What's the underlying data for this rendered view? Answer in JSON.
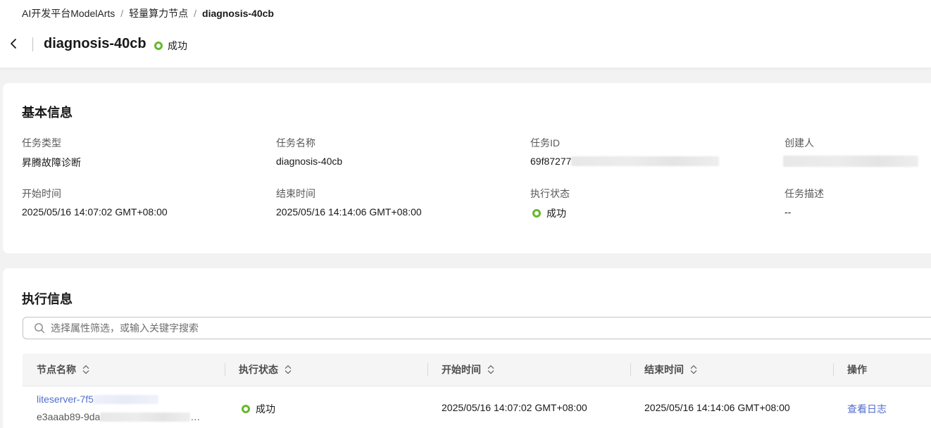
{
  "breadcrumb": {
    "items": [
      "AI开发平台ModelArts",
      "轻量算力节点"
    ],
    "current": "diagnosis-40cb",
    "separator": "/"
  },
  "header": {
    "title": "diagnosis-40cb",
    "status": "成功",
    "status_color": "#66b82e"
  },
  "basic": {
    "title": "基本信息",
    "fields": {
      "task_type": {
        "label": "任务类型",
        "value": "昇腾故障诊断"
      },
      "task_name": {
        "label": "任务名称",
        "value": "diagnosis-40cb"
      },
      "task_id": {
        "label": "任务ID",
        "value": "69f87277"
      },
      "creator": {
        "label": "创建人",
        "value": ""
      },
      "start_time": {
        "label": "开始时间",
        "value": "2025/05/16 14:07:02 GMT+08:00"
      },
      "end_time": {
        "label": "结束时间",
        "value": "2025/05/16 14:14:06 GMT+08:00"
      },
      "exec_status": {
        "label": "执行状态",
        "value": "成功"
      },
      "description": {
        "label": "任务描述",
        "value": "--"
      }
    }
  },
  "execution": {
    "title": "执行信息",
    "search_placeholder": "选择属性筛选，或输入关键字搜索",
    "columns": [
      "节点名称",
      "执行状态",
      "开始时间",
      "结束时间",
      "操作"
    ],
    "rows": [
      {
        "node_name": "liteserver-7f5",
        "node_id": "e3aaab89-9da",
        "node_id_tail": "…",
        "status": "成功",
        "start_time": "2025/05/16 14:07:02 GMT+08:00",
        "end_time": "2025/05/16 14:14:06 GMT+08:00",
        "action": "查看日志"
      }
    ]
  },
  "colors": {
    "accent_link": "#526ecc",
    "success": "#66b82e"
  }
}
